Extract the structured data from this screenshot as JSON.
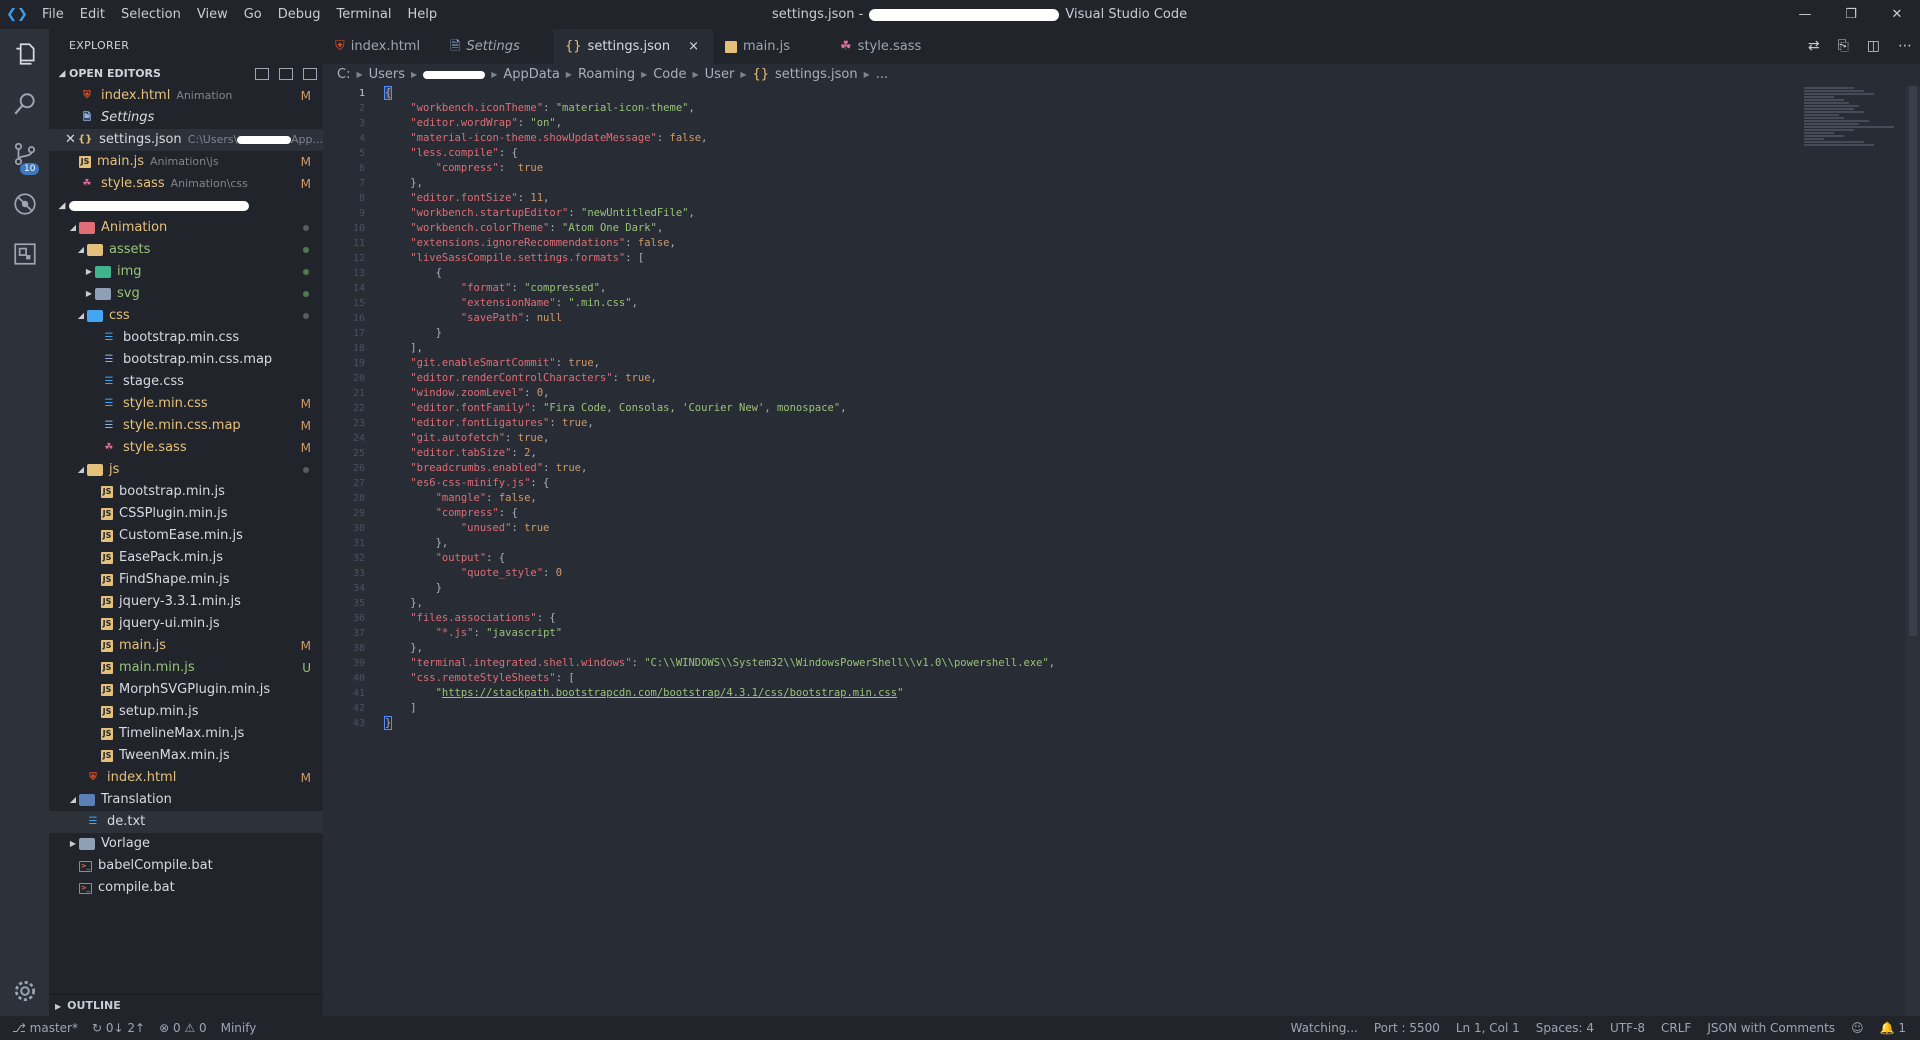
{
  "titlebar": {
    "menu": [
      "File",
      "Edit",
      "Selection",
      "View",
      "Go",
      "Debug",
      "Terminal",
      "Help"
    ],
    "title_prefix": "settings.json -",
    "title_suffix": "Visual Studio Code"
  },
  "activity": {
    "scm_badge": "10"
  },
  "sidebar": {
    "title": "EXPLORER",
    "open_editors_label": "OPEN EDITORS",
    "open_editors": [
      {
        "label": "index.html",
        "desc": "Animation",
        "status": "M"
      },
      {
        "label": "Settings",
        "desc": "",
        "status": ""
      },
      {
        "label": "settings.json",
        "desc": "C:\\Users\\",
        "desc2": "App...",
        "status": ""
      },
      {
        "label": "main.js",
        "desc": "Animation\\js",
        "status": "M"
      },
      {
        "label": "style.sass",
        "desc": "Animation\\css",
        "status": "M"
      }
    ],
    "tree": {
      "animation": "Animation",
      "assets": "assets",
      "img": "img",
      "svg": "svg",
      "css": "css",
      "css_files": [
        {
          "label": "bootstrap.min.css",
          "status": ""
        },
        {
          "label": "bootstrap.min.css.map",
          "status": ""
        },
        {
          "label": "stage.css",
          "status": ""
        },
        {
          "label": "style.min.css",
          "status": "M"
        },
        {
          "label": "style.min.css.map",
          "status": "M"
        },
        {
          "label": "style.sass",
          "status": "M"
        }
      ],
      "js": "js",
      "js_files": [
        {
          "label": "bootstrap.min.js",
          "status": ""
        },
        {
          "label": "CSSPlugin.min.js",
          "status": ""
        },
        {
          "label": "CustomEase.min.js",
          "status": ""
        },
        {
          "label": "EasePack.min.js",
          "status": ""
        },
        {
          "label": "FindShape.min.js",
          "status": ""
        },
        {
          "label": "jquery-3.3.1.min.js",
          "status": ""
        },
        {
          "label": "jquery-ui.min.js",
          "status": ""
        },
        {
          "label": "main.js",
          "status": "M"
        },
        {
          "label": "main.min.js",
          "status": "U"
        },
        {
          "label": "MorphSVGPlugin.min.js",
          "status": ""
        },
        {
          "label": "setup.min.js",
          "status": ""
        },
        {
          "label": "TimelineMax.min.js",
          "status": ""
        },
        {
          "label": "TweenMax.min.js",
          "status": ""
        }
      ],
      "index_html": "index.html",
      "index_status": "M",
      "translation": "Translation",
      "de_txt": "de.txt",
      "vorlage": "Vorlage",
      "babel_bat": "babelCompile.bat",
      "compile_bat": "compile.bat"
    },
    "outline_label": "OUTLINE"
  },
  "tabs": [
    {
      "label": "index.html"
    },
    {
      "label": "Settings"
    },
    {
      "label": "settings.json",
      "close": "×"
    },
    {
      "label": "main.js"
    },
    {
      "label": "style.sass"
    }
  ],
  "breadcrumb": [
    "C:",
    "Users",
    "AppData",
    "Roaming",
    "Code",
    "User",
    "settings.json",
    "..."
  ],
  "editor": {
    "line_numbers": [
      "1",
      "2",
      "3",
      "4",
      "5",
      "6",
      "7",
      "8",
      "9",
      "10",
      "11",
      "12",
      "13",
      "14",
      "15",
      "16",
      "17",
      "18",
      "19",
      "20",
      "21",
      "22",
      "23",
      "24",
      "25",
      "26",
      "27",
      "28",
      "29",
      "30",
      "31",
      "32",
      "33",
      "34",
      "35",
      "36",
      "37",
      "38",
      "39",
      "40",
      "41",
      "42",
      "43"
    ]
  },
  "statusbar": {
    "branch": "master*",
    "sync": "0↓ 2↑",
    "problems": "⊗ 0 ⚠ 0",
    "minify": "Minify",
    "watching": "Watching...",
    "port": "Port : 5500",
    "position": "Ln 1, Col 1",
    "spaces": "Spaces: 4",
    "encoding": "UTF-8",
    "eol": "CRLF",
    "language": "JSON with Comments",
    "notifications": "1"
  }
}
